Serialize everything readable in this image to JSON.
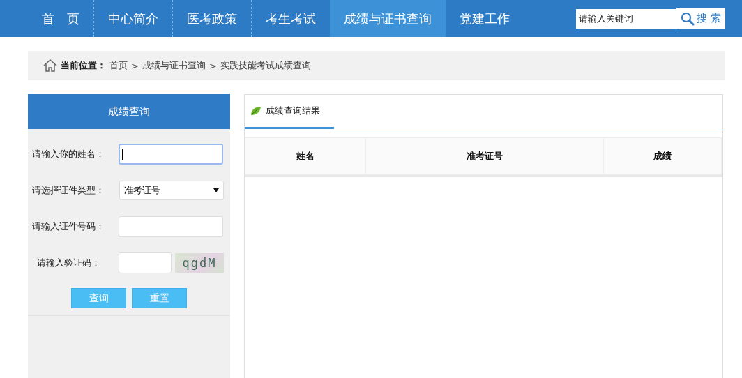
{
  "nav": {
    "items": [
      {
        "label": "首　页",
        "selected": false
      },
      {
        "label": "中心简介",
        "selected": false
      },
      {
        "label": "医考政策",
        "selected": false
      },
      {
        "label": "考生考试",
        "selected": false
      },
      {
        "label": "成绩与证书查询",
        "selected": true
      },
      {
        "label": "党建工作",
        "selected": false
      }
    ],
    "search": {
      "placeholder": "请输入关键词",
      "button": "搜 索"
    }
  },
  "breadcrumb": {
    "label": "当前位置：",
    "items": [
      "首页",
      "成绩与证书查询",
      "实践技能考试成绩查询"
    ],
    "separator": ">"
  },
  "query_panel": {
    "title": "成绩查询",
    "fields": [
      {
        "kind": "text",
        "label": "请输入你的姓名：",
        "focused": true
      },
      {
        "kind": "select",
        "label": "请选择证件类型：",
        "value": "准考证号"
      },
      {
        "kind": "text",
        "label": "请输入证件号码：",
        "focused": false
      },
      {
        "kind": "captcha",
        "label": "请输入验证码：",
        "captcha": "qgdM"
      }
    ],
    "buttons": [
      "查询",
      "重置"
    ]
  },
  "results": {
    "tab": "成绩查询结果",
    "table": {
      "columns": [
        "姓名",
        "准考证号",
        "成绩"
      ]
    }
  }
}
